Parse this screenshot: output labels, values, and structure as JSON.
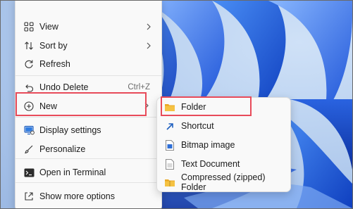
{
  "context_menu": {
    "items": [
      {
        "icon": "grid-icon",
        "label": "View",
        "has_submenu": true
      },
      {
        "icon": "sort-icon",
        "label": "Sort by",
        "has_submenu": true
      },
      {
        "icon": "refresh-icon",
        "label": "Refresh"
      },
      {
        "icon": "undo-icon",
        "label": "Undo Delete",
        "shortcut": "Ctrl+Z"
      },
      {
        "icon": "plus-circle-icon",
        "label": "New",
        "has_submenu": true,
        "highlighted": true
      },
      {
        "icon": "display-settings-icon",
        "label": "Display settings"
      },
      {
        "icon": "brush-icon",
        "label": "Personalize"
      },
      {
        "icon": "terminal-icon",
        "label": "Open in Terminal"
      },
      {
        "icon": "share-icon",
        "label": "Show more options"
      }
    ]
  },
  "new_submenu": {
    "items": [
      {
        "icon": "folder-icon",
        "label": "Folder",
        "highlighted": true
      },
      {
        "icon": "shortcut-arrow-icon",
        "label": "Shortcut"
      },
      {
        "icon": "bitmap-image-icon",
        "label": "Bitmap image"
      },
      {
        "icon": "text-document-icon",
        "label": "Text Document"
      },
      {
        "icon": "zipped-folder-icon",
        "label": "Compressed (zipped) Folder"
      }
    ]
  },
  "colors": {
    "highlight_box": "#e84b5a",
    "menu_background": "#f9f9f9",
    "wallpaper_blue": "#1f56d6",
    "folder_yellow": "#f5c242"
  }
}
